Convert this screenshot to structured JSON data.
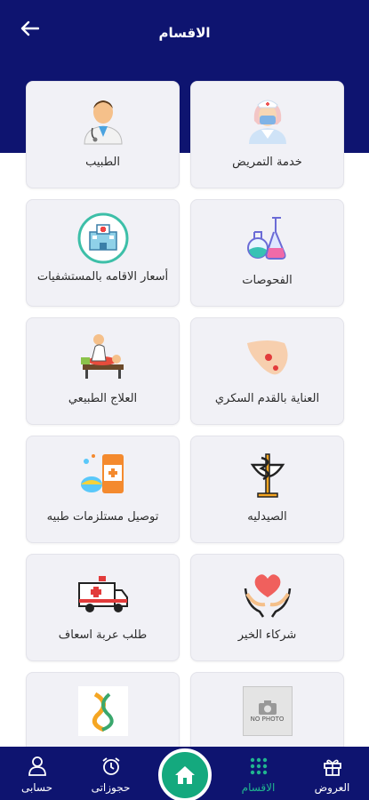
{
  "header": {
    "title": "الاقسام"
  },
  "categories": [
    {
      "label": "خدمة التمريض",
      "icon": "nurse-icon"
    },
    {
      "label": "الطبيب",
      "icon": "doctor-icon"
    },
    {
      "label": "الفحوصات",
      "icon": "lab-flasks-icon"
    },
    {
      "label": "أسعار الاقامه بالمستشفيات",
      "icon": "hospital-icon"
    },
    {
      "label": "العناية بالقدم السكري",
      "icon": "diabetic-foot-icon"
    },
    {
      "label": "العلاج الطبيعي",
      "icon": "physiotherapy-icon"
    },
    {
      "label": "الصيدليه",
      "icon": "pharmacy-icon"
    },
    {
      "label": "توصيل مستلزمات طبيه",
      "icon": "medical-supplies-icon"
    },
    {
      "label": "شركاء الخير",
      "icon": "charity-hands-heart-icon"
    },
    {
      "label": "طلب عربة اسعاف",
      "icon": "ambulance-icon"
    },
    {
      "label": "",
      "icon": "no-photo-icon",
      "image_text": "NO PHOTO"
    },
    {
      "label": "",
      "icon": "partner-logo-icon"
    }
  ],
  "bottom_nav": [
    {
      "label": "حسابى",
      "icon": "person-icon"
    },
    {
      "label": "حجوزاتى",
      "icon": "alarm-clock-icon"
    },
    {
      "label": "",
      "icon": "home-icon"
    },
    {
      "label": "الاقسام",
      "icon": "grid-dots-icon",
      "active": true
    },
    {
      "label": "العروض",
      "icon": "gift-icon"
    }
  ],
  "colors": {
    "primary": "#0e1470",
    "accent": "#14a97e",
    "active_tab": "#20b58f",
    "card_bg": "#f1f1f6"
  }
}
